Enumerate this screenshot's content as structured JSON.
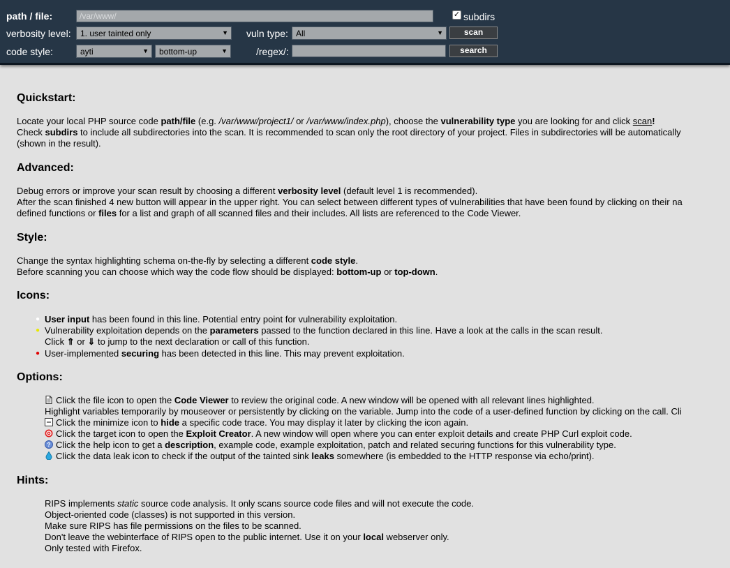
{
  "toolbar": {
    "path_label": "path / file:",
    "path_placeholder": "/var/www/",
    "subdirs_label": "subdirs",
    "subdirs_checked": true,
    "verbosity_label": "verbosity level:",
    "verbosity_value": "1. user tainted only",
    "vuln_type_label": "vuln type:",
    "vuln_type_value": "All",
    "scan_label": "scan",
    "code_style_label": "code style:",
    "code_style_value": "ayti",
    "flow_value": "bottom-up",
    "regex_label": "/regex/:",
    "search_label": "search"
  },
  "colors": {
    "topbar_bg": "#263646",
    "page_bg": "#e1e1e1",
    "bullet_white": "#ffffff",
    "bullet_yellow": "#e8e800",
    "bullet_red": "#e00000"
  },
  "sections": {
    "quickstart": {
      "title": "Quickstart:",
      "l1": [
        "Locate your local PHP source code ",
        "path/file",
        " (e.g. ",
        "/var/www/project1/",
        " or ",
        "/var/www/index.php",
        "), choose the ",
        "vulnerability type",
        " you are looking for and click ",
        "scan",
        "!"
      ],
      "l2": [
        "Check ",
        "subdirs",
        " to include all subdirectories into the scan. It is recommended to scan only the root directory of your project. Files in subdirectories will be automatically"
      ],
      "l3": "(shown in the result)."
    },
    "advanced": {
      "title": "Advanced:",
      "l1": [
        "Debug errors or improve your scan result by choosing a different ",
        "verbosity level",
        " (default level 1 is recommended)."
      ],
      "l2": "After the scan finished 4 new button will appear in the upper right. You can select between different types of vulnerabilities that have been found by clicking on their na",
      "l3": [
        "defined functions or ",
        "files",
        " for a list and graph of all scanned files and their includes. All lists are referenced to the Code Viewer."
      ]
    },
    "style": {
      "title": "Style:",
      "l1": [
        "Change the syntax highlighting schema on-the-fly by selecting a different ",
        "code style",
        "."
      ],
      "l2": [
        "Before scanning you can choose which way the code flow should be displayed: ",
        "bottom-up",
        " or ",
        "top-down",
        "."
      ]
    },
    "icons": {
      "title": "Icons:",
      "i1": [
        "User input",
        " has been found in this line. Potential entry point for vulnerability exploitation."
      ],
      "i2": [
        "Vulnerability exploitation depends on the ",
        "parameters",
        " passed to the function declared in this line. Have a look at the calls in the scan result."
      ],
      "i2b": [
        "Click ",
        "⇑",
        " or ",
        "⇓",
        " to jump to the next declaration or call of this function."
      ],
      "i3": [
        "User-implemented ",
        "securing",
        " has been detected in this line. This may prevent exploitation."
      ]
    },
    "options": {
      "title": "Options:",
      "o1": [
        "Click the file icon to open the ",
        "Code Viewer",
        " to review the original code. A new window will be opened with all relevant lines highlighted."
      ],
      "o1b": "Highlight variables temporarily by mouseover or persistently by clicking on the variable. Jump into the code of a user-defined function by clicking on the call. Cli",
      "o2": [
        "Click the minimize icon to ",
        "hide",
        " a specific code trace. You may display it later by clicking the icon again."
      ],
      "o3": [
        "Click the target icon to open the ",
        "Exploit Creator",
        ". A new window will open where you can enter exploit details and create PHP Curl exploit code."
      ],
      "o4": [
        "Click the help icon to get a ",
        "description",
        ", example code, example exploitation, patch and related securing functions for this vulnerability type."
      ],
      "o5": [
        "Click the data leak icon to check if the output of the tainted sink ",
        "leaks",
        " somewhere (is embedded to the HTTP response via echo/print)."
      ]
    },
    "hints": {
      "title": "Hints:",
      "h1": [
        "RIPS implements ",
        "static",
        " source code analysis. It only scans source code files and will not execute the code."
      ],
      "h2": "Object-oriented code (classes) is not supported in this version.",
      "h3": "Make sure RIPS has file permissions on the files to be scanned.",
      "h4": [
        "Don't leave the webinterface of RIPS open to the public internet. Use it on your ",
        "local",
        " webserver only."
      ],
      "h5": "Only tested with Firefox."
    }
  },
  "icon_names": [
    "file-icon",
    "minimize-icon",
    "target-icon",
    "help-icon",
    "data-leak-icon"
  ]
}
